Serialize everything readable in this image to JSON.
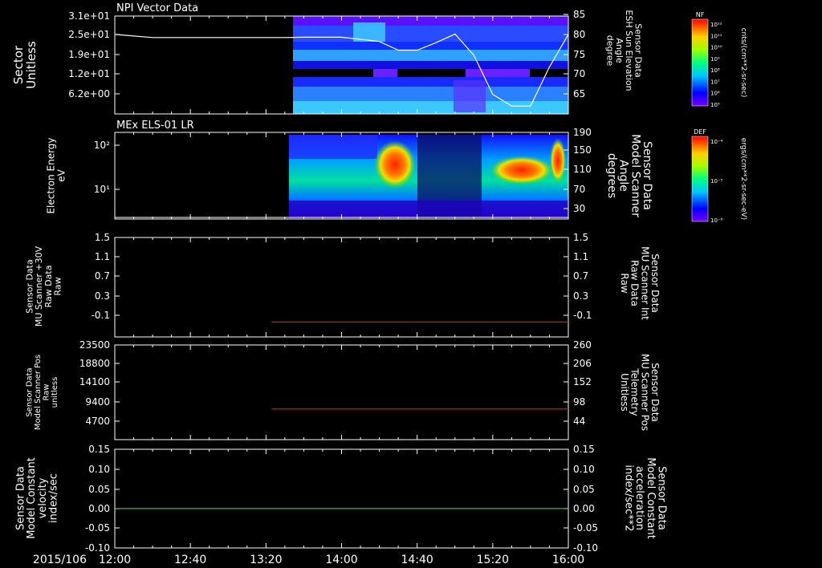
{
  "date_label": "2015/106",
  "time_ticks": [
    "12:00",
    "12:40",
    "13:20",
    "14:00",
    "14:40",
    "15:20",
    "16:00"
  ],
  "colors": {
    "red": "#e01010",
    "green": "#20e020",
    "white": "#ffffff"
  },
  "colorbars": [
    {
      "tag": "NF",
      "units": "cnts/(cm**2-sr-sec)",
      "ticks": [
        "10¹²",
        "10¹¹",
        "10¹⁰",
        "10⁹",
        "10⁸",
        "10⁷",
        "10⁶",
        "10⁵"
      ]
    },
    {
      "tag": "DEF",
      "units": "ergs/(cm**2-sr-sec-eV)",
      "ticks": [
        "10⁻⁴",
        "10⁻⁵",
        "10⁻⁶"
      ]
    }
  ],
  "chart_data": [
    {
      "type": "heatmap",
      "title": "NPI Vector Data",
      "ylabel": [
        "Sector",
        "Unitless"
      ],
      "yticks": [
        "3.1e+01",
        "2.5e+01",
        "1.9e+01",
        "1.2e+01",
        "6.2e+00"
      ],
      "y2label": [
        "Sensor Data",
        "ESH Sun Elevation",
        "Angle",
        "degree"
      ],
      "y2ticks": [
        "85",
        "80",
        "75",
        "70",
        "65"
      ],
      "y2lim": [
        60,
        85
      ],
      "line_series": {
        "x": [
          "12:00",
          "12:20",
          "12:40",
          "13:30",
          "13:40",
          "14:00",
          "14:20",
          "14:30",
          "14:40",
          "14:50",
          "15:00",
          "15:10",
          "15:20",
          "15:30",
          "15:40",
          "15:50",
          "16:00"
        ],
        "values": [
          80.3,
          79.5,
          79.5,
          79.5,
          79.6,
          79.6,
          78.5,
          76.3,
          76.3,
          78.2,
          80.4,
          75.0,
          65.0,
          62.0,
          62.0,
          72.0,
          80.3
        ]
      }
    },
    {
      "type": "heatmap",
      "title": "MEx ELS-01 LR",
      "ylabel": [
        "Electron Energy",
        "eV"
      ],
      "yticks": [
        "10²",
        "10¹"
      ],
      "y2label": [
        "Sensor Data",
        "Model Scanner",
        "Angle",
        "degrees"
      ],
      "y2ticks": [
        "190",
        "150",
        "110",
        "70",
        "30"
      ]
    },
    {
      "type": "line",
      "ylabel": [
        "Sensor Data",
        "MU Scanner +30V",
        "Raw Data",
        "Raw"
      ],
      "yticks": [
        "1.5",
        "1.1",
        "0.7",
        "0.3",
        "-0.1"
      ],
      "ylim": [
        -0.3,
        1.5
      ],
      "y2label": [
        "Sensor Data",
        "MU Scanner Int",
        "Raw Data",
        "Raw"
      ],
      "y2ticks": [
        "1.5",
        "1.1",
        "0.7",
        "0.3",
        "-0.1"
      ],
      "series": [
        {
          "x": [
            "13:23",
            "16:00"
          ],
          "values": [
            -0.03,
            -0.03
          ]
        }
      ]
    },
    {
      "type": "line",
      "ylabel": [
        "Sensor Data",
        "Model Scanner Pos",
        "Raw",
        "unitless"
      ],
      "yticks": [
        "23500",
        "18800",
        "14100",
        "9400",
        "4700"
      ],
      "y2label": [
        "Sensor Data",
        "MU Scanner Pos",
        "Telemetry",
        "Unitless"
      ],
      "y2ticks": [
        "260",
        "206",
        "152",
        "98",
        "44"
      ],
      "y2lim": [
        1,
        260
      ],
      "series": [
        {
          "x": [
            "13:23",
            "16:00"
          ],
          "values": [
            85,
            85
          ]
        }
      ]
    },
    {
      "type": "line",
      "ylabel": [
        "Sensor Data",
        "Model Constant",
        "velocity",
        "index/sec"
      ],
      "yticks": [
        "0.15",
        "0.10",
        "0.05",
        "0.00",
        "-0.05",
        "-0.10"
      ],
      "ylim": [
        -0.1,
        0.15
      ],
      "y2label": [
        "Sensor Data",
        "Model Constant",
        "acceleration",
        "index/sec**2"
      ],
      "y2ticks": [
        "0.15",
        "0.10",
        "0.05",
        "0.00",
        "-0.05",
        "-0.10"
      ],
      "series": [
        {
          "x": [
            "12:00",
            "16:00"
          ],
          "values": [
            0.0,
            0.0
          ]
        }
      ]
    }
  ]
}
